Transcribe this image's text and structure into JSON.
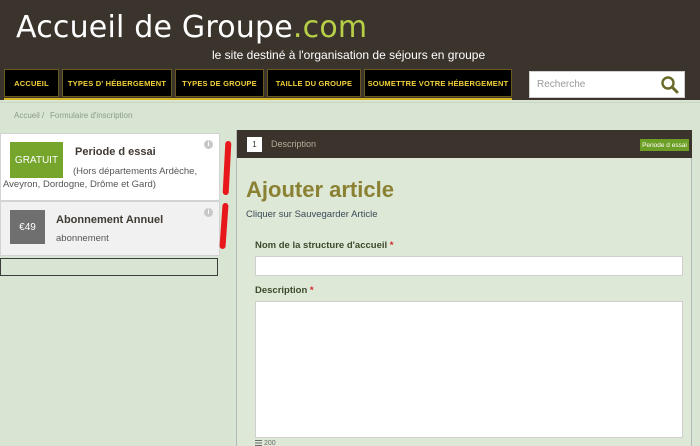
{
  "header": {
    "site_name": "Accueil de Groupe",
    "site_tld": ".com",
    "tagline": "le site destiné à l'organisation de séjours en groupe"
  },
  "nav": {
    "items": [
      {
        "label": "ACCUEIL"
      },
      {
        "label": "TYPES D' HÉBERGEMENT"
      },
      {
        "label": "TYPES DE GROUPE"
      },
      {
        "label": "TAILLE DU GROUPE"
      },
      {
        "label": "SOUMETTRE VOTRE HÉBERGEMENT"
      }
    ]
  },
  "search": {
    "placeholder": "Recherche",
    "icon": "search-icon"
  },
  "breadcrumb": {
    "home": "Accueil",
    "separator": "/",
    "current": "Formulaire d'inscription"
  },
  "plans": [
    {
      "badge": "GRATUIT",
      "title": "Periode d essai",
      "description": "(Hors départements Ardèche, Aveyron, Dordogne, Drôme et Gard)",
      "info_icon": "info-icon"
    },
    {
      "badge": "€49",
      "title": "Abonnement Annuel",
      "description": "abonnement",
      "info_icon": "info-icon"
    }
  ],
  "panel": {
    "step_number": "1",
    "step_label": "Description",
    "plan_tag": "Periode d essai"
  },
  "form": {
    "title": "Ajouter article",
    "subtitle": "Cliquer sur Sauvegarder Article",
    "fields": {
      "structure_name": {
        "label": "Nom de la structure d'accueil",
        "required_mark": "*",
        "value": ""
      },
      "description": {
        "label": "Description",
        "required_mark": "*",
        "value": ""
      }
    },
    "char_counter": "200"
  },
  "colors": {
    "header_bg": "#3b342d",
    "accent_green": "#76a52b",
    "nav_text": "#f4d23a",
    "page_bg": "#d9e5d3",
    "title_olive": "#8b8133",
    "required": "#d9232a"
  }
}
